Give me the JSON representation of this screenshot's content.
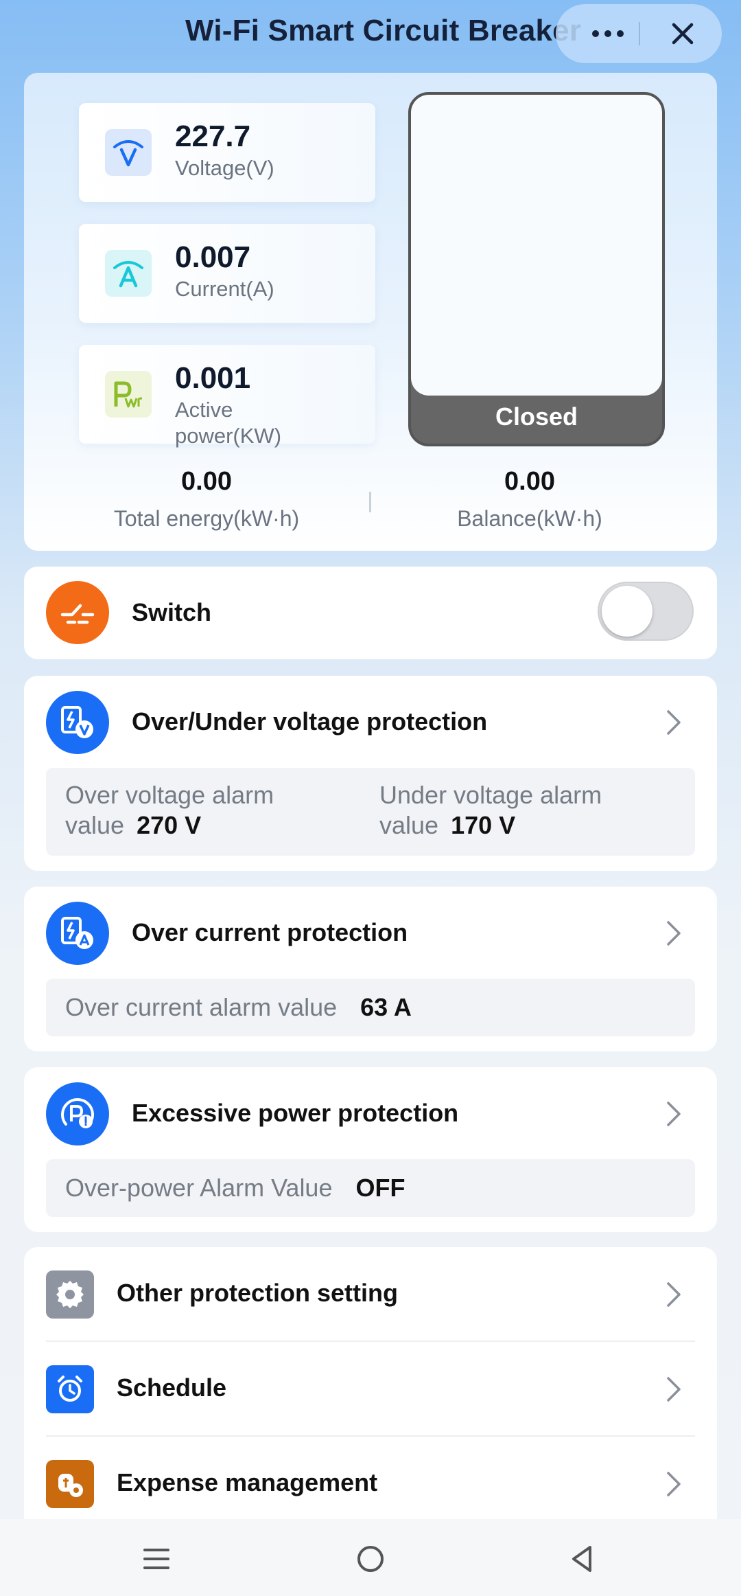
{
  "header": {
    "title": "Wi-Fi Smart Circuit Breaker",
    "more_icon": "more-dots-icon",
    "close_icon": "close-icon"
  },
  "metrics": [
    {
      "value": "227.7",
      "label": "Voltage(V)",
      "icon": "voltage-icon",
      "color": "#1a6ef5"
    },
    {
      "value": "0.007",
      "label": "Current(A)",
      "icon": "current-icon",
      "color": "#18c8d8"
    },
    {
      "value": "0.001",
      "label": "Active power(KW)",
      "icon": "power-icon",
      "color": "#8cbc2a"
    }
  ],
  "breaker": {
    "state": "Closed"
  },
  "totals": {
    "total_energy_value": "0.00",
    "total_energy_label": "Total energy(kW·h)",
    "balance_value": "0.00",
    "balance_label": "Balance(kW·h)"
  },
  "switch": {
    "label": "Switch",
    "on": false,
    "icon": "switch-icon",
    "color": "#f36b16"
  },
  "voltage_protection": {
    "title": "Over/Under voltage protection",
    "over_label": "Over voltage alarm value",
    "over_value": "270 V",
    "under_label": "Under voltage alarm value",
    "under_value": "170 V"
  },
  "current_protection": {
    "title": "Over current protection",
    "label": "Over current alarm value",
    "value": "63 A"
  },
  "power_protection": {
    "title": "Excessive power protection",
    "label": "Over-power Alarm Value",
    "value": "OFF"
  },
  "menu": [
    {
      "title": "Other protection setting",
      "icon": "gear-icon",
      "color": "#8e95a0"
    },
    {
      "title": "Schedule",
      "icon": "alarm-clock-icon",
      "color": "#1a6ef5"
    },
    {
      "title": "Expense management",
      "icon": "expense-gear-icon",
      "color": "#c96a0f"
    }
  ],
  "accent": "#1a6ef5",
  "nav": [
    "menu-icon",
    "home-icon",
    "back-icon"
  ]
}
